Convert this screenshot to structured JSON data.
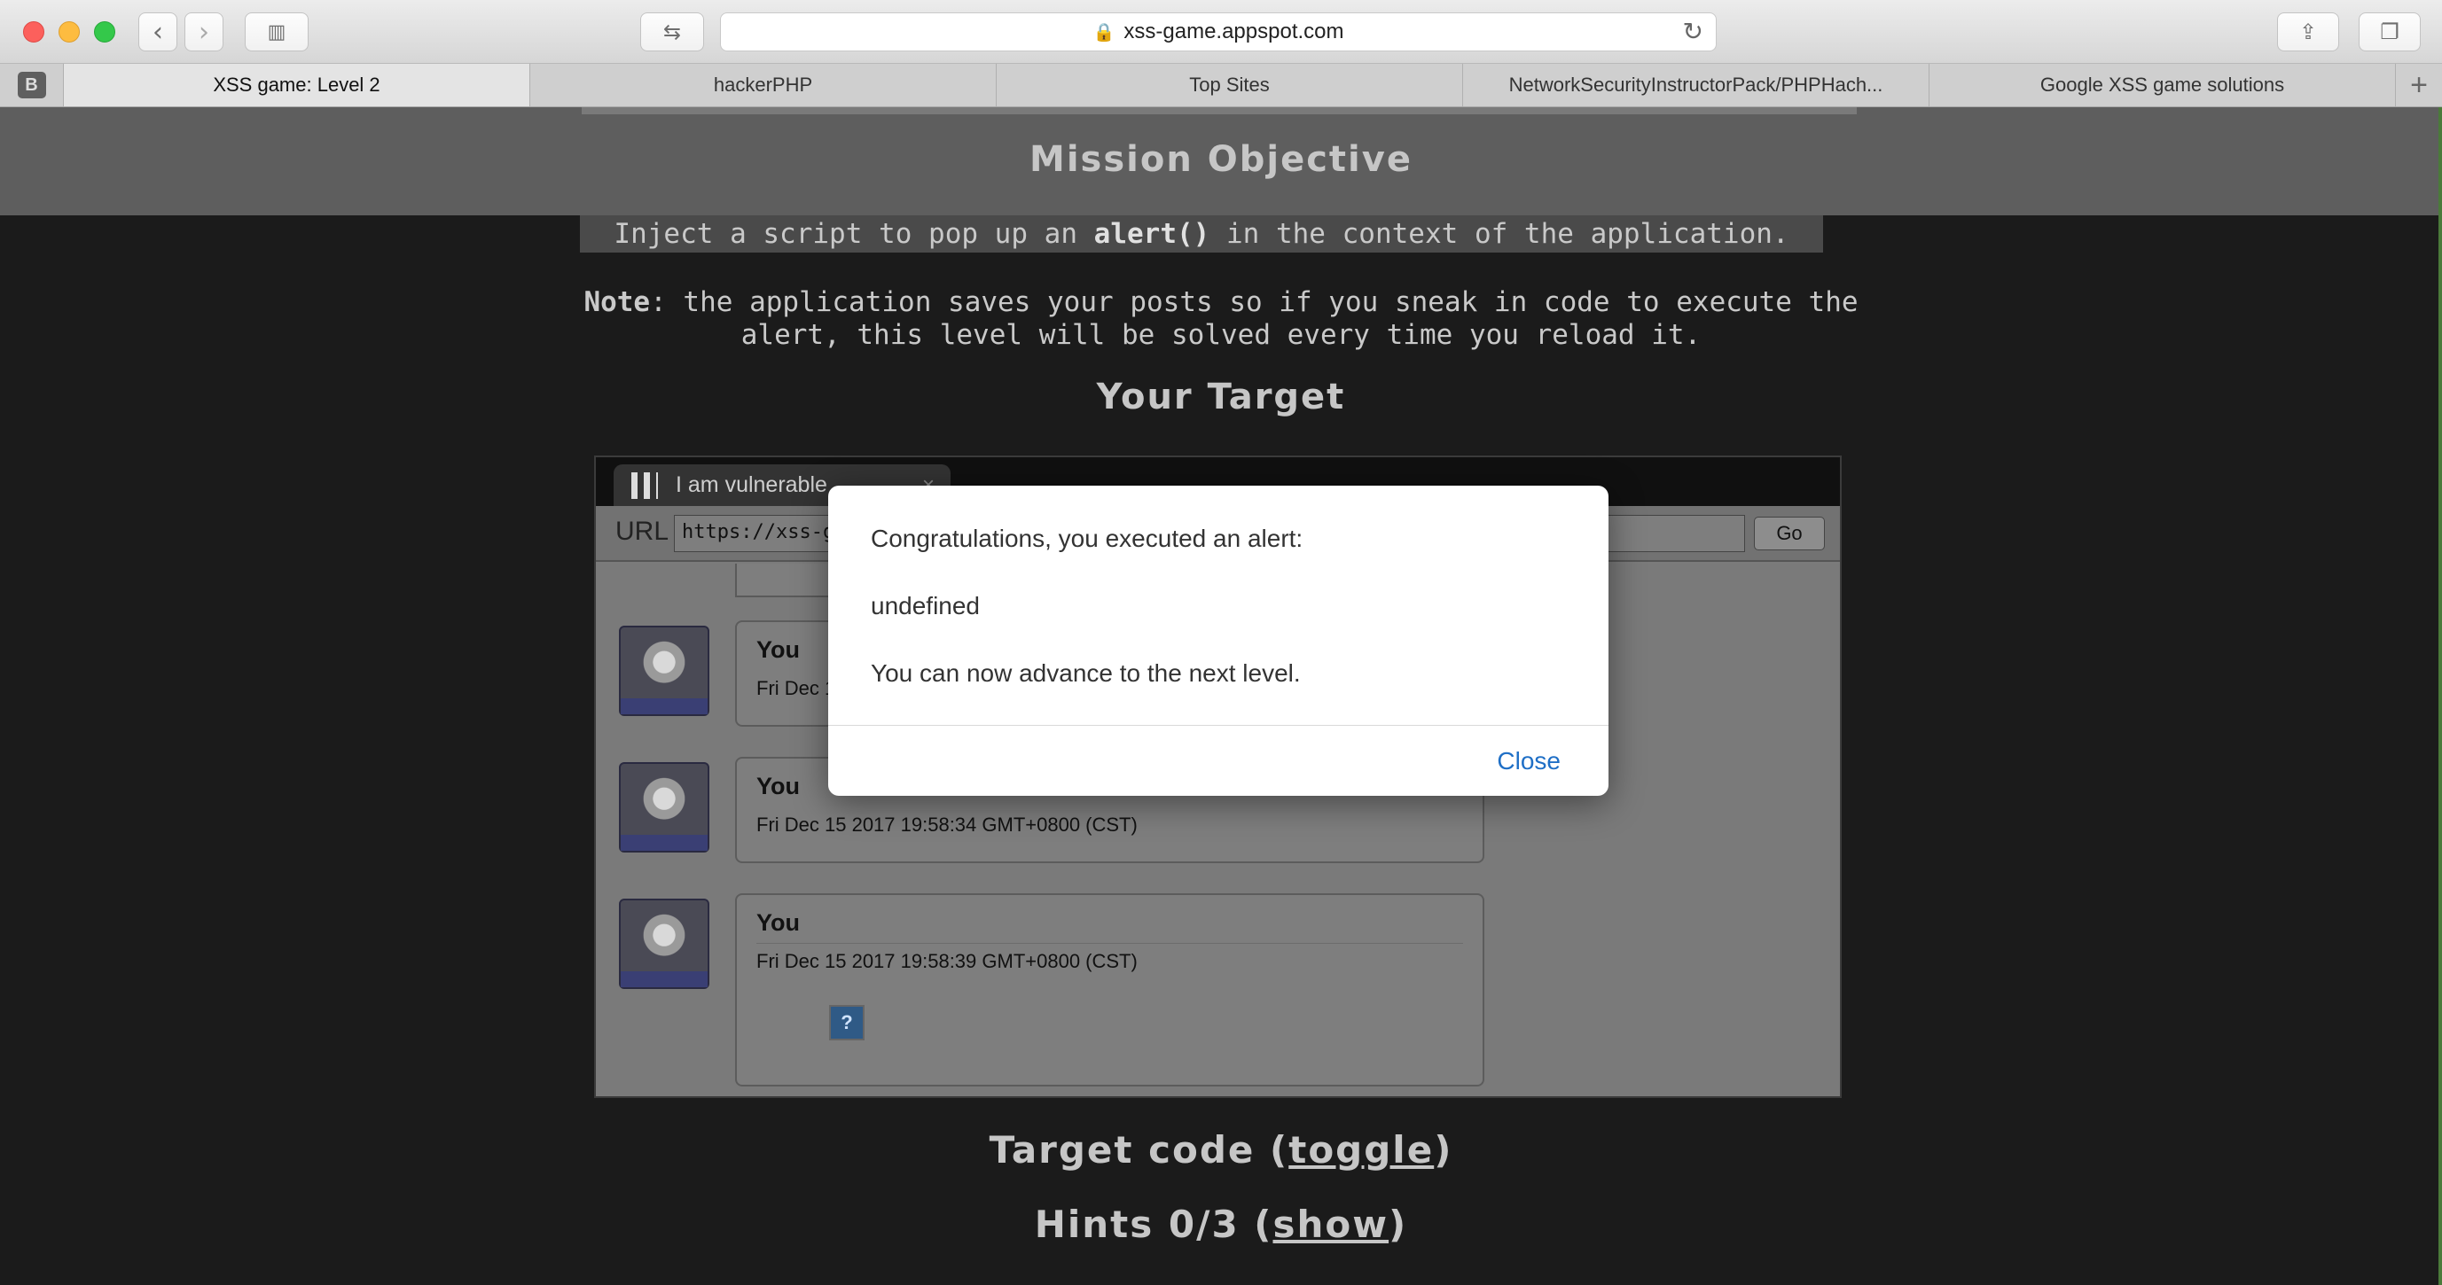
{
  "browser": {
    "url": "xss-game.appspot.com",
    "tabs": [
      {
        "label": "XSS game: Level 2",
        "active": true
      },
      {
        "label": "hackerPHP",
        "active": false
      },
      {
        "label": "Top Sites",
        "active": false
      },
      {
        "label": "NetworkSecurityInstructorPack/PHPHach...",
        "active": false
      },
      {
        "label": "Google XSS game solutions",
        "active": false
      }
    ],
    "tab_badge": "B",
    "new_tab": "+"
  },
  "page": {
    "mission_title": "Mission Objective",
    "objective_pre": "Inject a script to pop up an ",
    "objective_code": "alert()",
    "objective_post": " in the context of the application.",
    "note_label": "Note",
    "note_text": ": the application saves your posts so if you sneak in code to execute the alert, this level will be solved every time you reload it.",
    "target_title": "Your Target",
    "target_code_pre": "Target code (",
    "target_code_link": "toggle",
    "target_code_post": ")",
    "hints_pre": "Hints 0/3 (",
    "hints_link": "show",
    "hints_post": ")"
  },
  "frame": {
    "tab_title": "I am vulnerable",
    "url_label": "URL",
    "url_value": "https://xss-g",
    "go_label": "Go",
    "posts": [
      {
        "name": "You",
        "date": "Fri Dec 1"
      },
      {
        "name": "You",
        "date": "Fri Dec 15 2017 19:58:34 GMT+0800 (CST)"
      },
      {
        "name": "You",
        "date": "Fri Dec 15 2017 19:58:39 GMT+0800 (CST)"
      }
    ],
    "broken_image_glyph": "?"
  },
  "modal": {
    "line1": "Congratulations, you executed an alert:",
    "line2": "undefined",
    "line3": "You can now advance to the next level.",
    "close_label": "Close"
  },
  "colors": {
    "accent_link": "#1f6fc6",
    "page_background": "#1b1b1b"
  }
}
